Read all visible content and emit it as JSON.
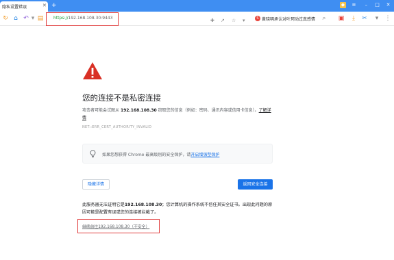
{
  "browser": {
    "tab_title": "隐私设置错误",
    "address_scheme": "https://",
    "address_host": "192.168.108.30:9443",
    "search_placeholder": "黄晓明承认对叶珂动过真感情"
  },
  "error_page": {
    "headline": "您的连接不是私密连接",
    "desc_prefix": "攻击者可能会试图从",
    "desc_host": "192.168.108.30",
    "desc_suffix": "窃取您的信息（例如：密码、通讯内容或信用卡信息）。",
    "learn_more": "了解详情",
    "error_code": "NET::ERR_CERT_AUTHORITY_INVALID",
    "hint_prefix": "如果您想获得 Chrome 最高级别的安全保护，请",
    "hint_link": "开启增强型保护",
    "details_button": "隐藏详情",
    "back_button": "返回安全连接",
    "details_prefix": "此服务器无法证明它是",
    "details_host": "192.168.108.30",
    "details_suffix": "；您计算机的操作系统不信任其安全证书。出现此问题的原因可能是配置有误或您的连接被拦截了。",
    "proceed_link": "继续前往192.168.108.30（不安全）"
  },
  "colors": {
    "tabstrip": "#3f8ef2",
    "warning_red": "#d93025",
    "primary_blue": "#1a73e8",
    "highlight_box": "#e03a3a"
  }
}
